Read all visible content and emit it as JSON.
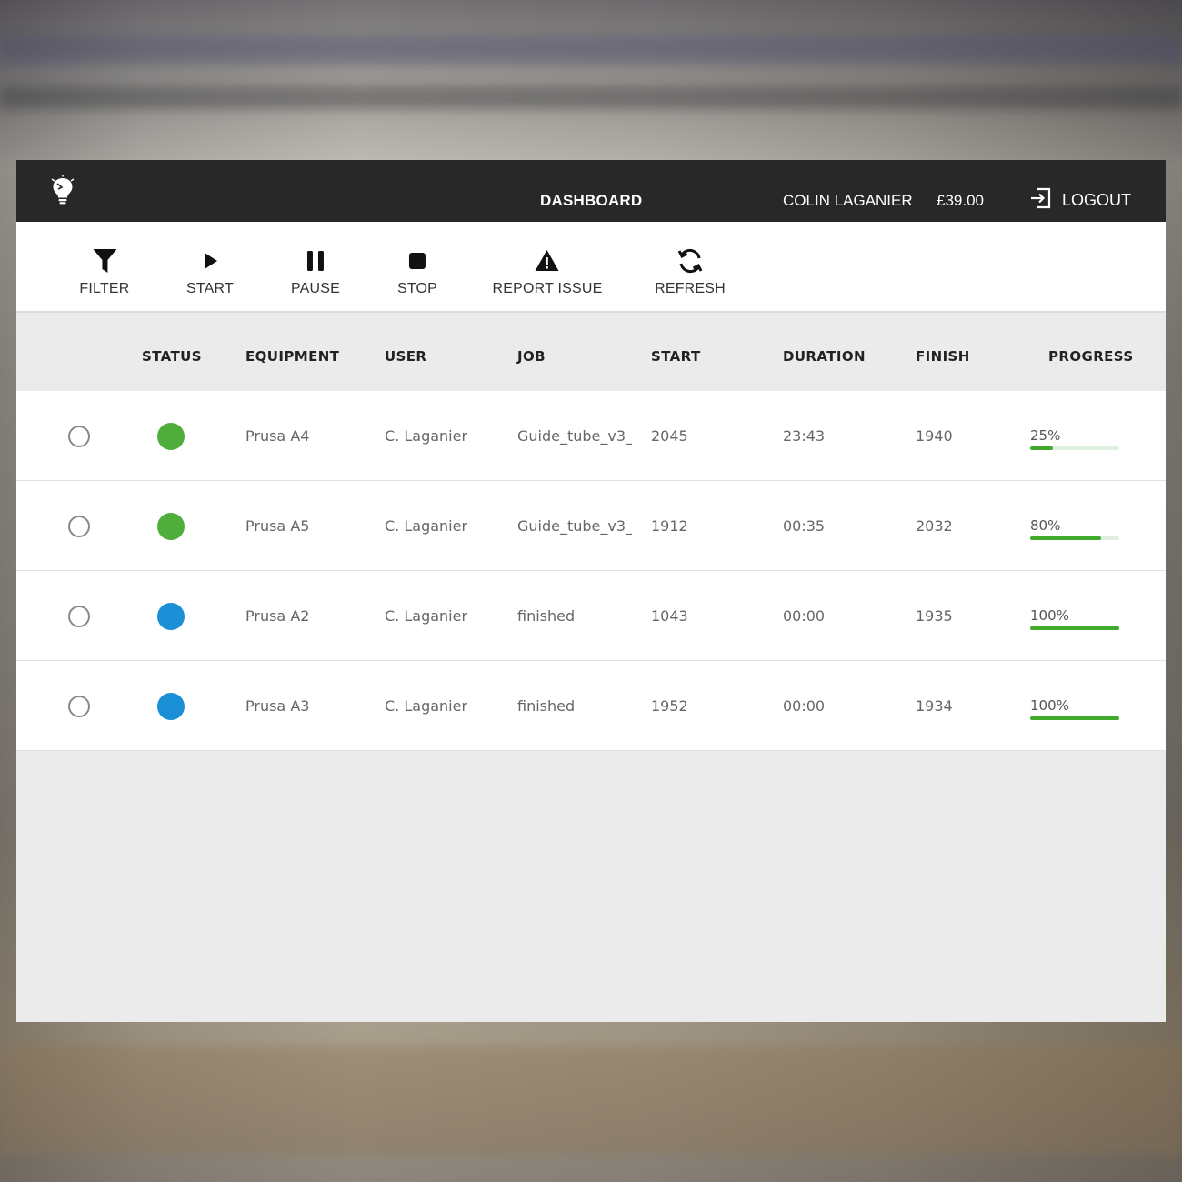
{
  "header": {
    "title": "DASHBOARD",
    "user_name": "COLIN LAGANIER",
    "balance": "£39.00",
    "logout_label": "LOGOUT",
    "logo_icon": "lightbulb-icon"
  },
  "toolbar": {
    "filter": "FILTER",
    "start": "START",
    "pause": "PAUSE",
    "stop": "STOP",
    "report_issue": "REPORT ISSUE",
    "refresh": "REFRESH"
  },
  "table": {
    "columns": {
      "status": "STATUS",
      "equipment": "EQUIPMENT",
      "user": "USER",
      "job": "JOB",
      "start": "START",
      "duration": "DURATION",
      "finish": "FINISH",
      "progress": "PROGRESS"
    },
    "rows": [
      {
        "status_color": "#4fae3b",
        "equipment": "Prusa A4",
        "user": "C. Laganier",
        "job": "Guide_tube_v3_",
        "start": "2045",
        "duration": "23:43",
        "finish": "1940",
        "progress_label": "25%",
        "progress": 0.25
      },
      {
        "status_color": "#4fae3b",
        "equipment": "Prusa A5",
        "user": "C. Laganier",
        "job": "Guide_tube_v3_",
        "start": "1912",
        "duration": "00:35",
        "finish": "2032",
        "progress_label": "80%",
        "progress": 0.8
      },
      {
        "status_color": "#1a8fd6",
        "equipment": "Prusa A2",
        "user": "C. Laganier",
        "job": "finished",
        "start": "1043",
        "duration": "00:00",
        "finish": "1935",
        "progress_label": "100%",
        "progress": 1.0
      },
      {
        "status_color": "#1a8fd6",
        "equipment": "Prusa A3",
        "user": "C. Laganier",
        "job": "finished",
        "start": "1952",
        "duration": "00:00",
        "finish": "1934",
        "progress_label": "100%",
        "progress": 1.0
      }
    ]
  },
  "colors": {
    "topbar": "#282828",
    "progress_fill": "#3faa2c",
    "status_running": "#4fae3b",
    "status_finished": "#1a8fd6"
  }
}
